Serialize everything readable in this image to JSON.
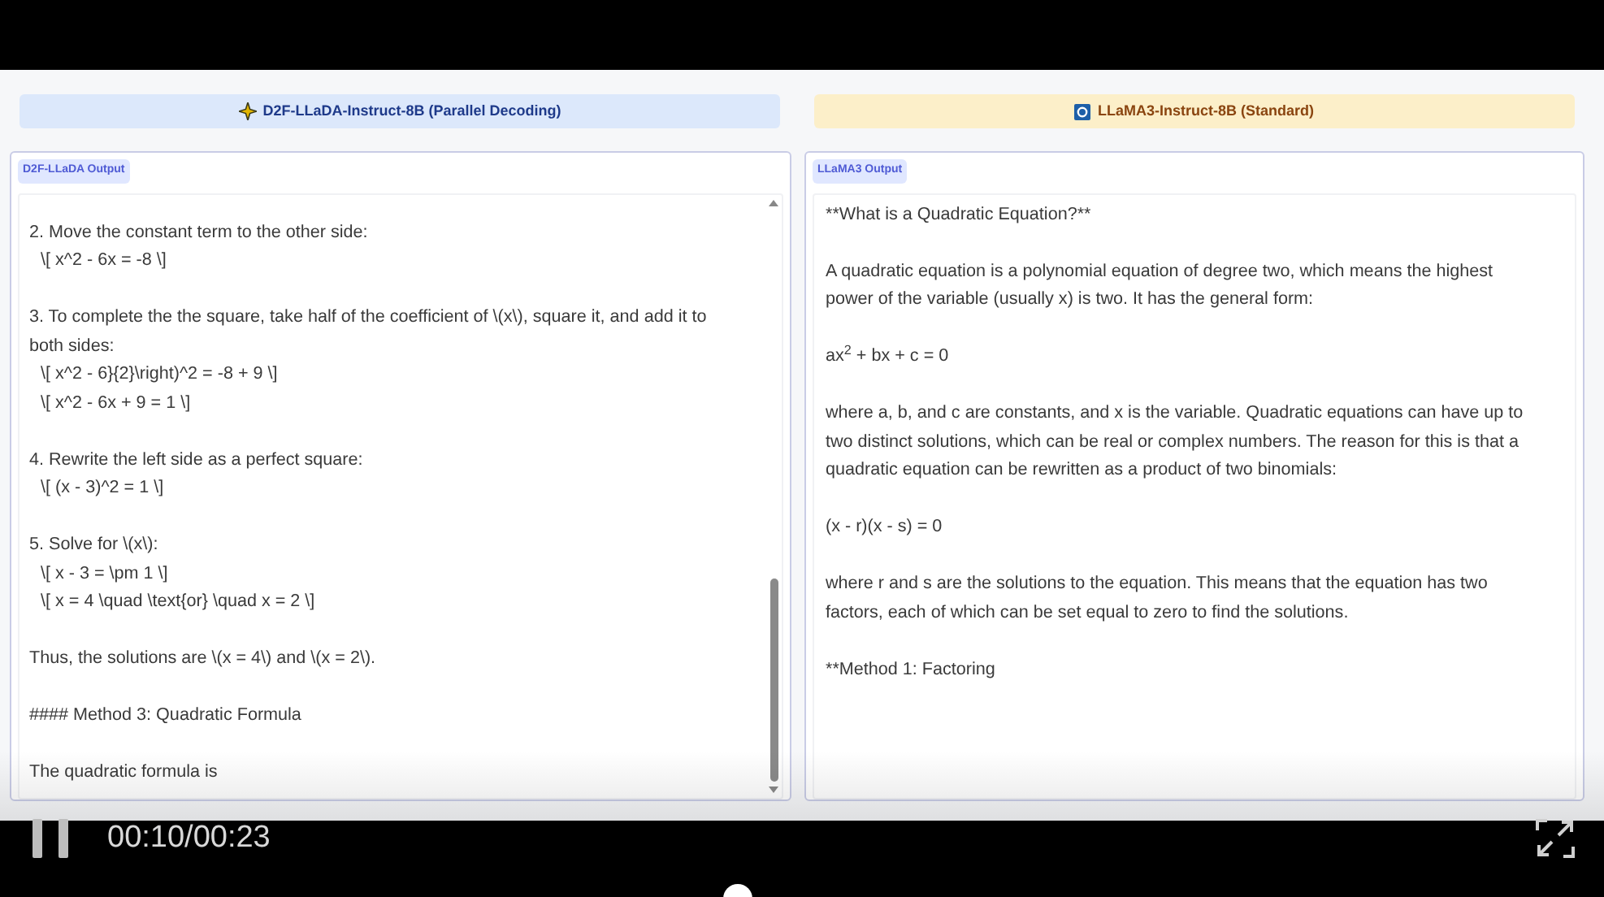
{
  "panels": [
    {
      "kind": "parallel",
      "title": "D2F-LLaDA-Instruct-8B (Parallel Decoding)",
      "output_label": "D2F-LLaDA Output",
      "scrollbar": true,
      "blocks": [
        [
          {
            "text": "2. Move the constant term to the other side:",
            "indent": false
          },
          {
            "text": "\\[ x^2 - 6x = -8 \\]",
            "indent": true
          }
        ],
        [
          {
            "text": "3. To complete the the square, take half of the coefficient of \\(x\\), square it, and add it to both sides:",
            "indent": false
          },
          {
            "text": "\\[ x^2 - 6}{2}\\right)^2 = -8 + 9 \\]",
            "indent": true
          },
          {
            "text": "\\[ x^2 - 6x + 9 = 1 \\]",
            "indent": true
          }
        ],
        [
          {
            "text": "4. Rewrite the left side as a perfect square:",
            "indent": false
          },
          {
            "text": "\\[ (x - 3)^2 = 1 \\]",
            "indent": true
          }
        ],
        [
          {
            "text": "5. Solve for \\(x\\):",
            "indent": false
          },
          {
            "text": "\\[ x - 3 = \\pm 1 \\]",
            "indent": true
          },
          {
            "text": "\\[ x = 4 \\quad \\text{or} \\quad x = 2 \\]",
            "indent": true
          }
        ],
        [
          {
            "text": "Thus, the solutions are \\(x = 4\\) and \\(x = 2\\).",
            "indent": false
          }
        ],
        [
          {
            "text": "#### Method 3: Quadratic Formula",
            "indent": false
          }
        ],
        [
          {
            "text": "The quadratic formula is",
            "indent": false
          }
        ]
      ]
    },
    {
      "kind": "standard",
      "title": "LLaMA3-Instruct-8B (Standard)",
      "output_label": "LLaMA3 Output",
      "scrollbar": false,
      "blocks": [
        [
          {
            "text": "**What is a Quadratic Equation?**",
            "indent": false
          }
        ],
        [
          {
            "text": "A quadratic equation is a polynomial equation of degree two, which means the highest power of the variable (usually x) is two. It has the general form:",
            "indent": false
          }
        ],
        [
          {
            "text": "ax$^{2}$ + bx + c = 0",
            "indent": false,
            "rich": true
          }
        ],
        [
          {
            "text": "where a, b, and c are constants, and x is the variable. Quadratic equations can have up to two distinct solutions, which can be real or complex numbers. The reason for this is that a quadratic equation can be rewritten as a product of two binomials:",
            "indent": false
          }
        ],
        [
          {
            "text": "(x - r)(x - s) = 0",
            "indent": false
          }
        ],
        [
          {
            "text": "where r and s are the solutions to the equation. This means that the equation has two factors, each of which can be set equal to zero to find the solutions.",
            "indent": false
          }
        ],
        [
          {
            "text": "**Method 1: Factoring",
            "indent": false
          }
        ]
      ]
    }
  ],
  "player": {
    "playing": true,
    "time": "00:10/00:23",
    "progress": {
      "level": 0.46
    }
  }
}
